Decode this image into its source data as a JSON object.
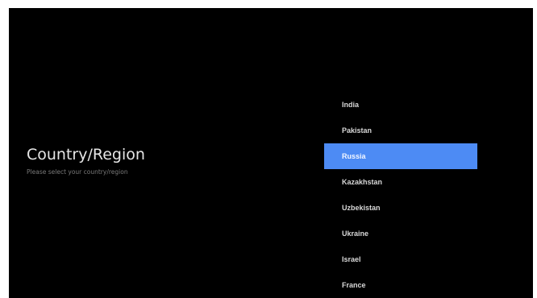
{
  "page": {
    "title": "Country/Region",
    "subtitle": "Please select your country/region"
  },
  "country_list": {
    "selected": "Russia",
    "items": [
      {
        "label": "India"
      },
      {
        "label": "Pakistan"
      },
      {
        "label": "Russia"
      },
      {
        "label": "Kazakhstan"
      },
      {
        "label": "Uzbekistan"
      },
      {
        "label": "Ukraine"
      },
      {
        "label": "Israel"
      },
      {
        "label": "France"
      }
    ]
  },
  "colors": {
    "background": "#000000",
    "highlight": "#4d8bf4",
    "title_text": "#e6e6e6",
    "subtitle_text": "#7a7a7a",
    "item_text": "#d8d8d8"
  }
}
